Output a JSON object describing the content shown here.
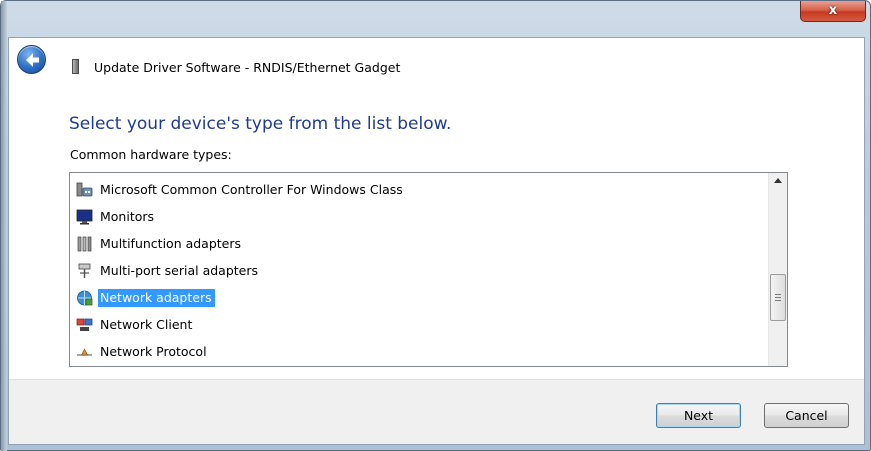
{
  "window": {
    "title": "Update Driver Software - RNDIS/Ethernet Gadget",
    "close_label": "x"
  },
  "instruction": "Select your device's type from the list below.",
  "list_label": "Common hardware types:",
  "hardware_types": [
    {
      "label": "Microsoft Common Controller For Windows Class",
      "icon": "controller-icon"
    },
    {
      "label": "Monitors",
      "icon": "monitor-icon"
    },
    {
      "label": "Multifunction adapters",
      "icon": "multifunction-adapter-icon"
    },
    {
      "label": "Multi-port serial adapters",
      "icon": "serial-port-icon"
    },
    {
      "label": "Network adapters",
      "icon": "network-adapter-icon",
      "selected": true
    },
    {
      "label": "Network Client",
      "icon": "network-client-icon"
    },
    {
      "label": "Network Protocol",
      "icon": "network-protocol-icon"
    }
  ],
  "buttons": {
    "next": "Next",
    "cancel": "Cancel"
  }
}
